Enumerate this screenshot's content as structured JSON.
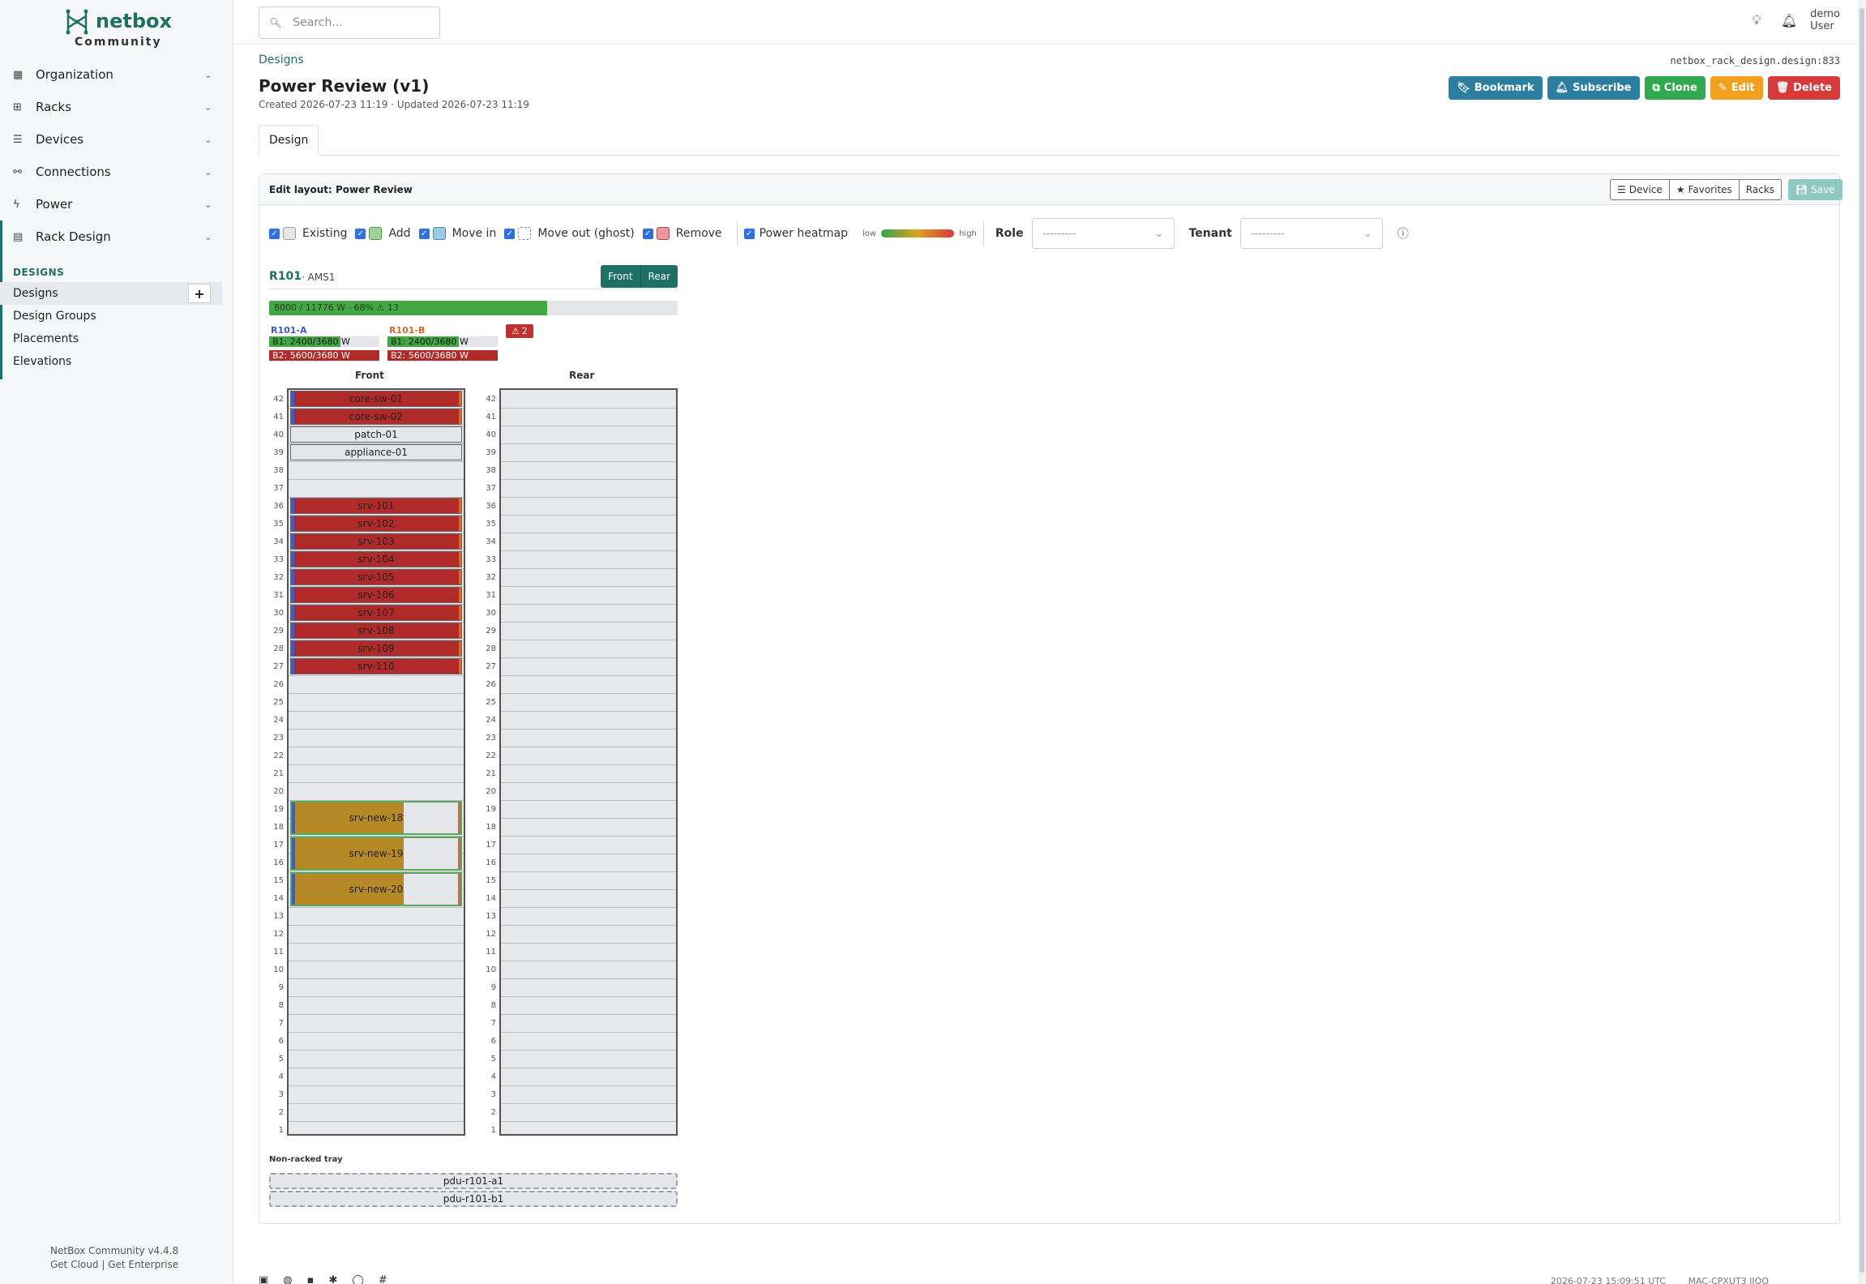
{
  "brand": {
    "name": "netbox",
    "edition": "Community"
  },
  "sidebar": {
    "sections": [
      {
        "label": "Organization",
        "icon": "organization-icon"
      },
      {
        "label": "Racks",
        "icon": "racks-icon"
      },
      {
        "label": "Devices",
        "icon": "devices-icon"
      },
      {
        "label": "Connections",
        "icon": "connections-icon"
      },
      {
        "label": "Power",
        "icon": "power-icon"
      },
      {
        "label": "Rack Design",
        "icon": "rack-design-icon"
      }
    ],
    "heading": "DESIGNS",
    "items": [
      "Designs",
      "Design Groups",
      "Placements",
      "Elevations"
    ],
    "add_label": "+",
    "footer_version": "NetBox Community v4.4.8",
    "footer_cloud": "Get Cloud",
    "footer_sep": "|",
    "footer_enterprise": "Get Enterprise"
  },
  "header": {
    "search_placeholder": "Search...",
    "user_name": "demo",
    "user_role": "User"
  },
  "page": {
    "breadcrumb": "Designs",
    "object_id": "netbox_rack_design.design:833",
    "title": "Power Review (v1)",
    "meta": "Created 2026-07-23 11:19 · Updated 2026-07-23 11:19",
    "actions": {
      "bookmark": "Bookmark",
      "subscribe": "Subscribe",
      "clone": "Clone",
      "edit": "Edit",
      "delete": "Delete"
    },
    "tab": "Design"
  },
  "editor": {
    "title": "Edit layout: Power Review",
    "buttons": {
      "device": "Device",
      "favorites": "Favorites",
      "racks": "Racks",
      "save": "Save"
    },
    "legend": [
      {
        "label": "Existing",
        "color": "#e4e6e9",
        "border": "#9aa0a6",
        "dashed": false
      },
      {
        "label": "Add",
        "color": "#9ed39e",
        "border": "#4a9a4a",
        "dashed": false
      },
      {
        "label": "Move in",
        "color": "#9ec7e0",
        "border": "#4a8ab0",
        "dashed": false
      },
      {
        "label": "Move out (ghost)",
        "color": "#ffffff",
        "border": "#888888",
        "dashed": true
      },
      {
        "label": "Remove",
        "color": "#e89a9a",
        "border": "#c04040",
        "dashed": false
      }
    ],
    "heatmap_label": "Power heatmap",
    "heatmap_low": "low",
    "heatmap_high": "high",
    "role_label": "Role",
    "role_value": "---------",
    "tenant_label": "Tenant",
    "tenant_value": "---------"
  },
  "rack": {
    "name": "R101",
    "site": "· AMS1",
    "front_label": "Front",
    "rear_label": "Rear",
    "power_summary": "8000 / 11776 W · 68% ⚠ 13",
    "power_fraction": 0.68,
    "feeds": [
      {
        "name": "R101-A",
        "color": "#3a5ad0",
        "rows": [
          {
            "text": "B1: 2400/3680 W",
            "fraction": 0.65,
            "fill": "#43a843"
          },
          {
            "text": "B2: 5600/3680 W",
            "fraction": 1.0,
            "fill": "#b02a2a"
          }
        ]
      },
      {
        "name": "R101-B",
        "color": "#d46a2a",
        "rows": [
          {
            "text": "B1: 2400/3680 W",
            "fraction": 0.65,
            "fill": "#43a843"
          },
          {
            "text": "B2: 5600/3680 W",
            "fraction": 1.0,
            "fill": "#b02a2a"
          }
        ]
      }
    ],
    "warning": "2",
    "front_title": "Front",
    "rear_title": "Rear",
    "units": 42,
    "devices": [
      {
        "name": "core-sw-01",
        "top_u": 42,
        "height_u": 1,
        "style": "red"
      },
      {
        "name": "core-sw-02",
        "top_u": 41,
        "height_u": 1,
        "style": "red"
      },
      {
        "name": "patch-01",
        "top_u": 40,
        "height_u": 1,
        "style": "gray"
      },
      {
        "name": "appliance-01",
        "top_u": 39,
        "height_u": 1,
        "style": "gray"
      },
      {
        "name": "srv-101",
        "top_u": 36,
        "height_u": 1,
        "style": "red"
      },
      {
        "name": "srv-102",
        "top_u": 35,
        "height_u": 1,
        "style": "red"
      },
      {
        "name": "srv-103",
        "top_u": 34,
        "height_u": 1,
        "style": "red"
      },
      {
        "name": "srv-104",
        "top_u": 33,
        "height_u": 1,
        "style": "red"
      },
      {
        "name": "srv-105",
        "top_u": 32,
        "height_u": 1,
        "style": "red"
      },
      {
        "name": "srv-106",
        "top_u": 31,
        "height_u": 1,
        "style": "red"
      },
      {
        "name": "srv-107",
        "top_u": 30,
        "height_u": 1,
        "style": "red"
      },
      {
        "name": "srv-108",
        "top_u": 29,
        "height_u": 1,
        "style": "red"
      },
      {
        "name": "srv-109",
        "top_u": 28,
        "height_u": 1,
        "style": "red"
      },
      {
        "name": "srv-110",
        "top_u": 27,
        "height_u": 1,
        "style": "red"
      },
      {
        "name": "srv-new-18",
        "top_u": 19,
        "height_u": 2,
        "style": "new"
      },
      {
        "name": "srv-new-19",
        "top_u": 17,
        "height_u": 2,
        "style": "new"
      },
      {
        "name": "srv-new-20",
        "top_u": 15,
        "height_u": 2,
        "style": "new"
      }
    ],
    "tray_label": "Non-racked tray",
    "tray_items": [
      "pdu-r101-a1",
      "pdu-r101-b1"
    ]
  },
  "footer": {
    "timestamp": "2026-07-23 15:09:51 UTC",
    "build": "MAC-CPXUT3 IIOO"
  }
}
